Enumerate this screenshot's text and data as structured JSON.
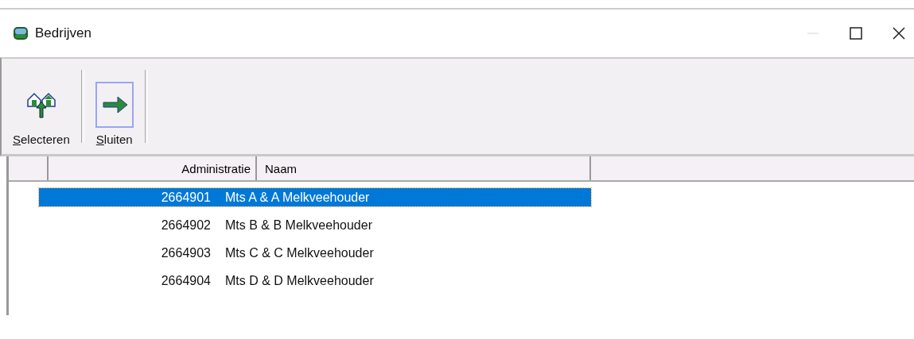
{
  "window": {
    "title": "Bedrijven",
    "minimize_disabled": true
  },
  "toolbar": [
    {
      "kind": "select",
      "label": "Selecteren",
      "selected": false
    },
    {
      "kind": "close",
      "label": "Sluiten",
      "selected": true
    }
  ],
  "table": {
    "columns": [
      "Administratie",
      "Naam"
    ],
    "rows": [
      {
        "cells": [
          "2664901",
          "Mts A & A Melkveehouder"
        ],
        "selected": true
      },
      {
        "cells": [
          "2664902",
          "Mts B & B Melkveehouder"
        ],
        "selected": false
      },
      {
        "cells": [
          "2664903",
          "Mts C & C Melkveehouder"
        ],
        "selected": false
      },
      {
        "cells": [
          "2664904",
          "Mts D & D Melkveehouder"
        ],
        "selected": false
      }
    ]
  }
}
